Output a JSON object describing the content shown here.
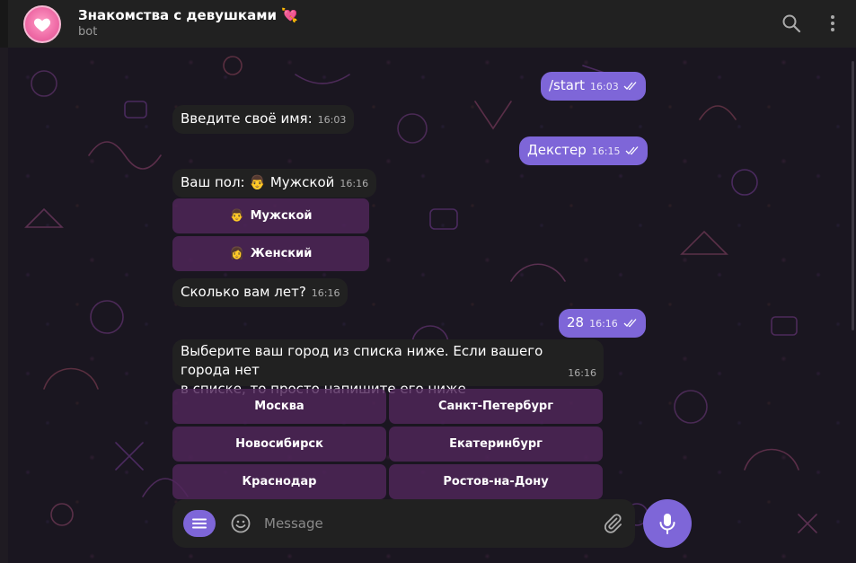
{
  "header": {
    "title": "Знакомства с девушками 💘",
    "subtitle": "bot"
  },
  "icons": {
    "search": "search-icon",
    "more": "more-vertical-icon",
    "attach": "paperclip-icon",
    "emoji": "smile-icon",
    "menu": "menu-lines-icon",
    "mic": "microphone-icon",
    "read": "double-check-icon"
  },
  "colors": {
    "accent": "#7e66d8",
    "header_bg": "#212121",
    "incoming_bubble": "#212121",
    "keyboard_button": "#50265a"
  },
  "messages": [
    {
      "text": "/start",
      "time": "16:03"
    },
    {
      "text": "Введите своё имя:",
      "time": "16:03"
    },
    {
      "text": "Декстер",
      "time": "16:15"
    },
    {
      "text": "Ваш пол: 👨 Мужской",
      "time": "16:16"
    },
    {
      "text": "Сколько вам лет?",
      "time": "16:16"
    },
    {
      "text": "28",
      "time": "16:16"
    },
    {
      "line1": "Выберите ваш город из списка ниже. Если вашего города нет",
      "line2": "в списке, то просто напишите его ниже",
      "time": "16:16"
    }
  ],
  "gender_buttons": [
    {
      "emoji": "👨",
      "label": "Мужской"
    },
    {
      "emoji": "👩",
      "label": "Женский"
    }
  ],
  "city_buttons": [
    "Москва",
    "Санкт-Петербург",
    "Новосибирск",
    "Екатеринбург",
    "Краснодар",
    "Ростов-на-Дону"
  ],
  "composer": {
    "placeholder": "Message"
  }
}
